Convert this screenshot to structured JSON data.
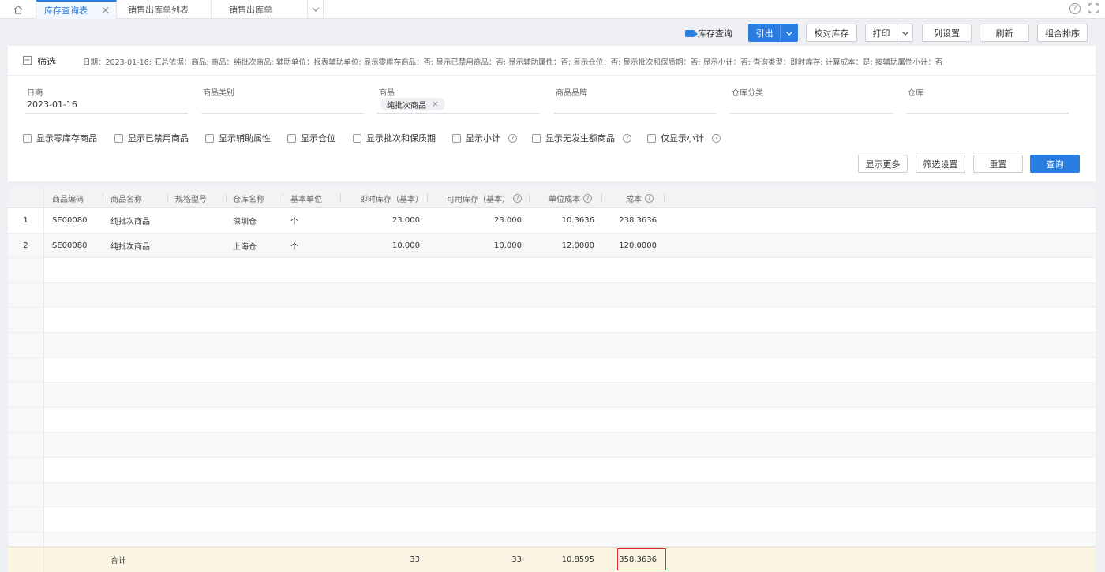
{
  "tabs": [
    {
      "label": "库存查询表",
      "active": true
    },
    {
      "label": "销售出库单列表",
      "active": false
    },
    {
      "label": "销售出库单",
      "active": false
    }
  ],
  "toolbar": {
    "stock_query": "库存查询",
    "export": "引出",
    "reconcile": "校对库存",
    "print": "打印",
    "columns": "列设置",
    "refresh": "刷新",
    "combo_sort": "组合排序"
  },
  "filter": {
    "title": "筛选",
    "summary": "日期：2023-01-16; 汇总依据：商品; 商品：纯批次商品; 辅助单位：报表辅助单位; 显示零库存商品：否; 显示已禁用商品：否; 显示辅助属性：否; 显示仓位：否; 显示批次和保质期：否; 显示小计：否; 查询类型：即时库存; 计算成本：是; 按辅助属性小计：否",
    "fields": [
      {
        "label": "日期",
        "value": "2023-01-16"
      },
      {
        "label": "商品类别",
        "value": ""
      },
      {
        "label": "商品",
        "value": "",
        "chip": "纯批次商品"
      },
      {
        "label": "商品品牌",
        "value": ""
      },
      {
        "label": "仓库分类",
        "value": ""
      },
      {
        "label": "仓库",
        "value": ""
      }
    ],
    "checks": [
      {
        "label": "显示零库存商品",
        "help": false
      },
      {
        "label": "显示已禁用商品",
        "help": false
      },
      {
        "label": "显示辅助属性",
        "help": false
      },
      {
        "label": "显示仓位",
        "help": false
      },
      {
        "label": "显示批次和保质期",
        "help": false
      },
      {
        "label": "显示小计",
        "help": true
      },
      {
        "label": "显示无发生额商品",
        "help": true
      },
      {
        "label": "仅显示小计",
        "help": true
      }
    ],
    "show_more": "显示更多",
    "filter_settings": "筛选设置",
    "reset": "重置",
    "query": "查询"
  },
  "grid": {
    "columns": [
      "商品编码",
      "商品名称",
      "规格型号",
      "仓库名称",
      "基本单位",
      "即时库存（基本）",
      "可用库存（基本）",
      "单位成本",
      "成本"
    ],
    "rows": [
      {
        "no": "1",
        "code": "SE00080",
        "name": "纯批次商品",
        "spec": "",
        "warehouse": "深圳仓",
        "unit": "个",
        "instant": "23.000",
        "available": "23.000",
        "unit_cost": "10.3636",
        "cost": "238.3636"
      },
      {
        "no": "2",
        "code": "SE00080",
        "name": "纯批次商品",
        "spec": "",
        "warehouse": "上海仓",
        "unit": "个",
        "instant": "10.000",
        "available": "10.000",
        "unit_cost": "12.0000",
        "cost": "120.0000"
      }
    ],
    "total": {
      "label": "合计",
      "instant": "33",
      "available": "33",
      "unit_cost": "10.8595",
      "cost": "358.3636"
    }
  },
  "colors": {
    "accent": "#2a7de1",
    "highlight": "#e0282d",
    "total_bg": "#fdf5e4"
  }
}
